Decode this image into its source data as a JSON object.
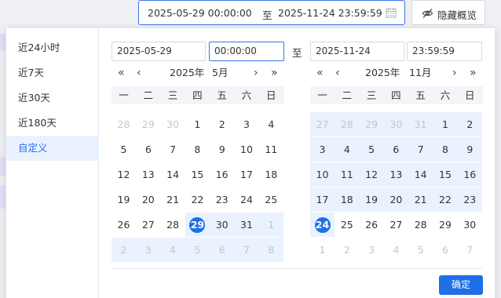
{
  "range": {
    "start": "2025-05-29 00:00:00",
    "separator": "至",
    "end": "2025-11-24 23:59:59",
    "accent": "#3a76e8"
  },
  "hide_button": {
    "label": "隐藏概览"
  },
  "sidebar": {
    "items": [
      "近24小时",
      "近7天",
      "近30天",
      "近180天",
      "自定义"
    ],
    "active": "自定义"
  },
  "start": {
    "date": "2025-05-29",
    "time": "00:00:00"
  },
  "end": {
    "date": "2025-11-24",
    "time": "23:59:59"
  },
  "to_label": "至",
  "weekdays": [
    "一",
    "二",
    "三",
    "四",
    "五",
    "六",
    "日"
  ],
  "nav": {
    "prev_year": "«",
    "prev_month": "‹",
    "next_month": "›",
    "next_year": "»"
  },
  "left_cal": {
    "year": "2025年",
    "month": "5月",
    "days": [
      "28",
      "29",
      "30",
      "1",
      "2",
      "3",
      "4",
      "5",
      "6",
      "7",
      "8",
      "9",
      "10",
      "11",
      "12",
      "13",
      "14",
      "15",
      "16",
      "17",
      "18",
      "19",
      "20",
      "21",
      "22",
      "23",
      "24",
      "25",
      "26",
      "27",
      "28",
      "29",
      "30",
      "31",
      "1",
      "2",
      "3",
      "4",
      "5",
      "6",
      "7",
      "8"
    ],
    "current_month_start": 3,
    "current_month_end": 33,
    "selected": 31
  },
  "right_cal": {
    "year": "2025年",
    "month": "11月",
    "days": [
      "27",
      "28",
      "29",
      "30",
      "31",
      "1",
      "2",
      "3",
      "4",
      "5",
      "6",
      "7",
      "8",
      "9",
      "10",
      "11",
      "12",
      "13",
      "14",
      "15",
      "16",
      "17",
      "18",
      "19",
      "20",
      "21",
      "22",
      "23",
      "24",
      "25",
      "26",
      "27",
      "28",
      "29",
      "30",
      "1",
      "2",
      "3",
      "4",
      "5",
      "6",
      "7"
    ],
    "current_month_start": 5,
    "current_month_end": 34,
    "selected": 28
  },
  "confirm": {
    "label": "确定",
    "color": "#1f6fe6"
  }
}
